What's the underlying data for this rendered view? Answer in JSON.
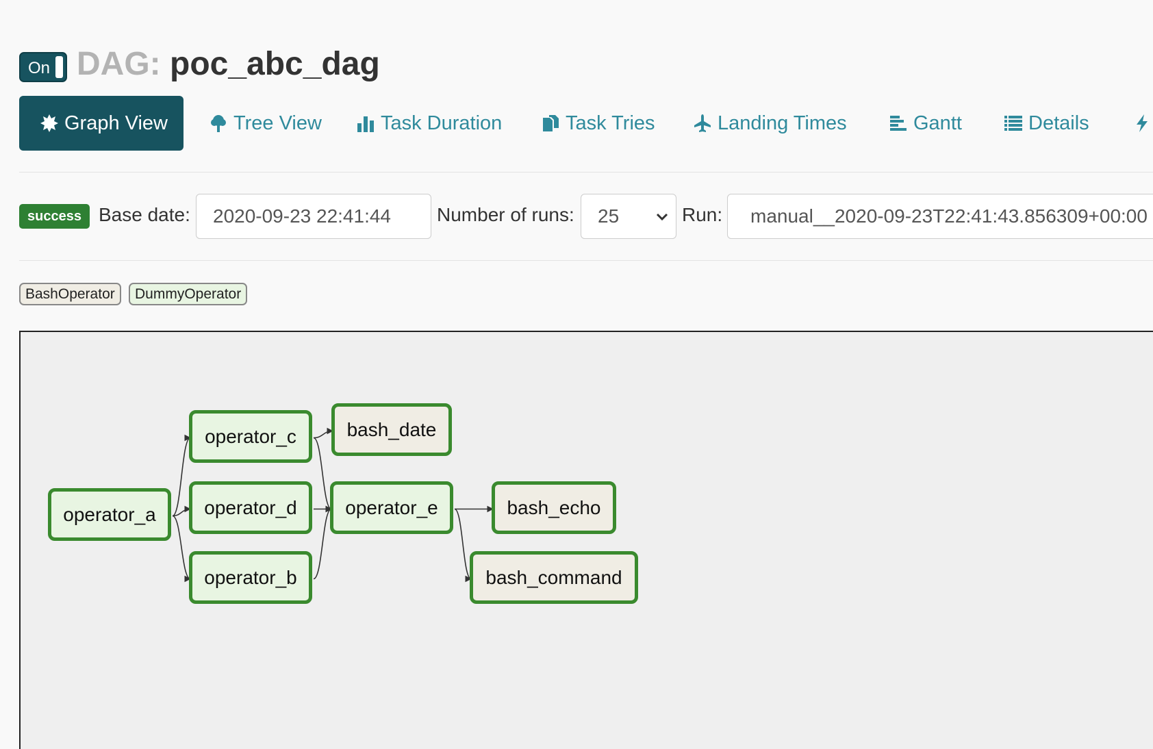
{
  "header": {
    "toggle_label": "On",
    "dag_prefix": "DAG:",
    "dag_name": "poc_abc_dag"
  },
  "nav": {
    "tabs": [
      {
        "label": "Graph View",
        "icon": "graph-icon",
        "active": true
      },
      {
        "label": "Tree View",
        "icon": "tree-icon"
      },
      {
        "label": "Task Duration",
        "icon": "bar-chart-icon"
      },
      {
        "label": "Task Tries",
        "icon": "files-icon"
      },
      {
        "label": "Landing Times",
        "icon": "plane-icon"
      },
      {
        "label": "Gantt",
        "icon": "gantt-icon"
      },
      {
        "label": "Details",
        "icon": "list-icon"
      }
    ],
    "overflow_icon": "bolt-icon"
  },
  "controls": {
    "status_badge": "success",
    "base_date_label": "Base date:",
    "base_date_value": "2020-09-23 22:41:44",
    "num_runs_label": "Number of runs:",
    "num_runs_value": "25",
    "run_label": "Run:",
    "run_value": "manual__2020-09-23T22:41:43.856309+00:00"
  },
  "legend": {
    "items": [
      "BashOperator",
      "DummyOperator"
    ],
    "colors": {
      "BashOperator": "#f0ede4",
      "DummyOperator": "#e8f5e2"
    }
  },
  "graph": {
    "node_border_color": "#3a8a2e",
    "nodes": [
      {
        "id": "operator_a",
        "label": "operator_a",
        "type": "DummyOperator"
      },
      {
        "id": "operator_c",
        "label": "operator_c",
        "type": "DummyOperator"
      },
      {
        "id": "operator_d",
        "label": "operator_d",
        "type": "DummyOperator"
      },
      {
        "id": "operator_b",
        "label": "operator_b",
        "type": "DummyOperator"
      },
      {
        "id": "bash_date",
        "label": "bash_date",
        "type": "BashOperator"
      },
      {
        "id": "operator_e",
        "label": "operator_e",
        "type": "DummyOperator"
      },
      {
        "id": "bash_echo",
        "label": "bash_echo",
        "type": "BashOperator"
      },
      {
        "id": "bash_command",
        "label": "bash_command",
        "type": "BashOperator"
      }
    ],
    "edges": [
      [
        "operator_a",
        "operator_c"
      ],
      [
        "operator_a",
        "operator_d"
      ],
      [
        "operator_a",
        "operator_b"
      ],
      [
        "operator_c",
        "bash_date"
      ],
      [
        "operator_c",
        "operator_e"
      ],
      [
        "operator_d",
        "operator_e"
      ],
      [
        "operator_b",
        "operator_e"
      ],
      [
        "operator_e",
        "bash_echo"
      ],
      [
        "operator_e",
        "bash_command"
      ]
    ]
  }
}
